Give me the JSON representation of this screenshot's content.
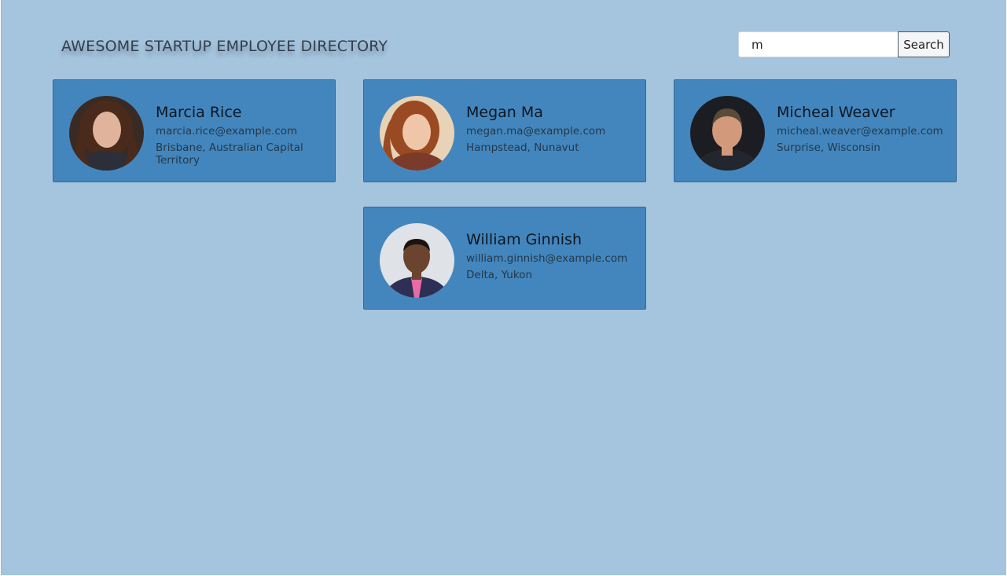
{
  "header": {
    "title": "AWESOME STARTUP EMPLOYEE DIRECTORY"
  },
  "search": {
    "value": "m",
    "button_label": "Search"
  },
  "employees": [
    {
      "name": "Marcia Rice",
      "email": "marcia.rice@example.com",
      "location": "Brisbane, Australian Capital Territory",
      "photo": "woman-dark-curly-hair-photo",
      "colors": {
        "bg": "#3a2a24",
        "hair": "#4a2a1a",
        "skin": "#e0b49c",
        "clothes": "#2c2f3a"
      }
    },
    {
      "name": "Megan Ma",
      "email": "megan.ma@example.com",
      "location": "Hampstead, Nunavut",
      "photo": "woman-auburn-hair-photo",
      "colors": {
        "bg": "#e9d3b6",
        "hair": "#9a4a22",
        "skin": "#f0c6a8",
        "clothes": "#7a3b2a"
      }
    },
    {
      "name": "Micheal Weaver",
      "email": "micheal.weaver@example.com",
      "location": "Surprise, Wisconsin",
      "photo": "man-short-hair-photo",
      "colors": {
        "bg": "#1c1d22",
        "hair": "#5a4a3a",
        "skin": "#d29a7a",
        "clothes": "#23262c"
      }
    },
    {
      "name": "William Ginnish",
      "email": "william.ginnish@example.com",
      "location": "Delta, Yukon",
      "photo": "man-suit-tie-photo",
      "colors": {
        "bg": "#dfe2e6",
        "hair": "#1a1410",
        "skin": "#6b4430",
        "clothes": "#2d2f55"
      }
    }
  ]
}
